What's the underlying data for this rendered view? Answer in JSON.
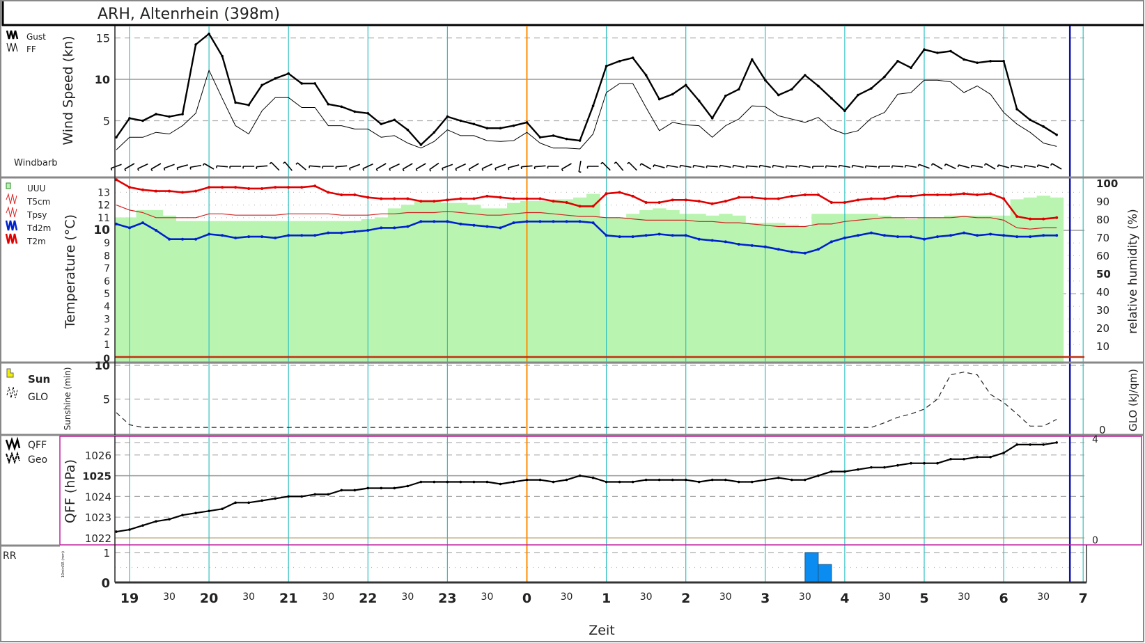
{
  "title": "ARH, Altenrhein (398m)",
  "colors": {
    "gust": "#000000",
    "ff": "#000000",
    "t2m": "#e00000",
    "t5cm": "#d02020",
    "td2m": "#0022cc",
    "uuu": "#b9f5b0",
    "rr": "#0a8cf0",
    "hour_grid": "#30c0c0",
    "now_line": "#ff8c00",
    "end_line": "#1010b0",
    "qff_box": "#c020a0"
  },
  "legends": {
    "wind": [
      "Gust",
      "FF"
    ],
    "windbarb": "Windbarb",
    "temp": [
      "UUU",
      "T5cm",
      "Tpsy",
      "Td2m",
      "T2m"
    ],
    "sun": [
      "Sun",
      "GLO"
    ],
    "qff": [
      "QFF",
      "Geo"
    ],
    "rr": "RR"
  },
  "axes": {
    "wind_ylabel": "Wind Speed (kn)",
    "temp_ylabel": "Temperature (°C)",
    "rh_ylabel": "relative humidity (%)",
    "sun_ylabel": "Sunshine (min)",
    "glo_ylabel": "GLO (kJ/qm)",
    "qff_ylabel": "QFF (hPa)",
    "rr_ylabel": "10minRR (mm)",
    "xlabel": "Zeit"
  },
  "chart_data": [
    {
      "panel": "wind",
      "type": "line",
      "ylabel": "Wind Speed (kn)",
      "ylim": [
        0,
        16
      ],
      "yticks": [
        "5",
        "10",
        "15"
      ],
      "grid": true,
      "x_start": "18:50",
      "x_step_min": 10,
      "series": [
        {
          "name": "Gust",
          "values": [
            3.0,
            5.3,
            5.0,
            5.8,
            5.5,
            5.8,
            14.2,
            15.5,
            12.8,
            7.2,
            6.9,
            9.3,
            10.1,
            10.7,
            9.5,
            9.5,
            7.0,
            6.7,
            6.1,
            5.9,
            4.6,
            5.1,
            3.9,
            2.1,
            3.6,
            5.5,
            5.0,
            4.6,
            4.1,
            4.1,
            4.4,
            4.8,
            3.0,
            3.2,
            2.8,
            2.6,
            6.8,
            11.6,
            12.2,
            12.6,
            10.5,
            7.6,
            8.2,
            9.3,
            7.4,
            5.3,
            8.0,
            8.8,
            12.4,
            9.9,
            8.1,
            8.8,
            10.5,
            9.2,
            7.7,
            6.2,
            8.1,
            8.9,
            10.3,
            12.2,
            11.4,
            13.6,
            13.2,
            13.4,
            12.4,
            12.0,
            12.2,
            12.2,
            6.4,
            5.1,
            4.3,
            3.3
          ]
        },
        {
          "name": "FF",
          "values": [
            1.5,
            3.0,
            3.0,
            3.6,
            3.4,
            4.4,
            5.9,
            11.1,
            7.7,
            4.4,
            3.4,
            6.2,
            7.8,
            7.8,
            6.6,
            6.6,
            4.4,
            4.4,
            4.0,
            4.0,
            3.0,
            3.2,
            2.3,
            1.7,
            2.5,
            3.9,
            3.2,
            3.2,
            2.6,
            2.5,
            2.6,
            3.6,
            2.3,
            1.7,
            1.7,
            1.6,
            3.4,
            8.4,
            9.5,
            9.5,
            6.6,
            3.8,
            4.8,
            4.5,
            4.4,
            3.0,
            4.4,
            5.2,
            6.8,
            6.7,
            5.6,
            5.2,
            4.8,
            5.4,
            4.0,
            3.4,
            3.8,
            5.3,
            6.0,
            8.2,
            8.4,
            9.9,
            9.9,
            9.7,
            8.4,
            9.2,
            8.2,
            6.0,
            4.6,
            3.6,
            2.3,
            1.9
          ]
        }
      ],
      "windbarb_dir_deg": [
        250,
        240,
        245,
        240,
        250,
        255,
        260,
        300,
        275,
        270,
        270,
        265,
        315,
        320,
        310,
        275,
        270,
        265,
        250,
        245,
        240,
        245,
        240,
        240,
        235,
        250,
        245,
        240,
        245,
        250,
        255,
        265,
        265,
        270,
        240,
        190,
        270,
        315,
        320,
        315,
        300,
        285,
        280,
        280,
        280,
        275,
        280,
        280,
        275,
        280,
        280,
        275,
        280,
        270,
        275,
        280,
        280,
        275,
        270,
        275,
        280,
        290,
        300,
        295,
        285,
        280,
        300,
        285,
        280,
        280,
        285,
        300
      ]
    },
    {
      "panel": "temperature",
      "type": "line",
      "ylabel": "Temperature (°C)",
      "ylim": [
        0,
        14
      ],
      "yticks": [
        "0",
        "1",
        "2",
        "3",
        "4",
        "5",
        "6",
        "7",
        "8",
        "9",
        "10",
        "11",
        "12",
        "13"
      ],
      "y2label": "relative humidity (%)",
      "y2lim": [
        0,
        100
      ],
      "y2ticks": [
        "0",
        "10",
        "20",
        "30",
        "40",
        "50",
        "60",
        "70",
        "80",
        "90",
        "100"
      ],
      "x_start": "18:50",
      "x_step_min": 10,
      "series": [
        {
          "name": "T2m",
          "values": [
            14.0,
            13.4,
            13.2,
            13.1,
            13.1,
            13.0,
            13.1,
            13.4,
            13.4,
            13.4,
            13.3,
            13.3,
            13.4,
            13.4,
            13.4,
            13.5,
            13.0,
            12.8,
            12.8,
            12.6,
            12.5,
            12.5,
            12.5,
            12.3,
            12.3,
            12.4,
            12.5,
            12.5,
            12.7,
            12.6,
            12.5,
            12.5,
            12.5,
            12.3,
            12.2,
            11.9,
            11.9,
            12.9,
            13.0,
            12.7,
            12.2,
            12.2,
            12.4,
            12.4,
            12.3,
            12.1,
            12.3,
            12.6,
            12.6,
            12.5,
            12.5,
            12.7,
            12.8,
            12.8,
            12.2,
            12.2,
            12.4,
            12.5,
            12.5,
            12.7,
            12.7,
            12.8,
            12.8,
            12.8,
            12.9,
            12.8,
            12.9,
            12.5,
            11.1,
            10.9,
            10.9,
            11.0
          ]
        },
        {
          "name": "T5cm",
          "values": [
            12.0,
            11.6,
            11.4,
            11.0,
            11.0,
            11.0,
            11.0,
            11.3,
            11.3,
            11.2,
            11.2,
            11.2,
            11.2,
            11.3,
            11.3,
            11.3,
            11.3,
            11.2,
            11.2,
            11.2,
            11.3,
            11.3,
            11.4,
            11.4,
            11.4,
            11.5,
            11.4,
            11.3,
            11.2,
            11.2,
            11.3,
            11.4,
            11.4,
            11.3,
            11.2,
            11.1,
            11.1,
            11.0,
            11.0,
            10.9,
            10.8,
            10.8,
            10.8,
            10.8,
            10.7,
            10.7,
            10.6,
            10.6,
            10.5,
            10.4,
            10.3,
            10.3,
            10.3,
            10.5,
            10.5,
            10.7,
            10.8,
            10.9,
            11.0,
            11.0,
            11.0,
            11.0,
            11.0,
            11.0,
            11.1,
            11.0,
            11.0,
            10.8,
            10.2,
            10.1,
            10.2,
            10.2
          ]
        },
        {
          "name": "Td2m",
          "values": [
            10.5,
            10.2,
            10.6,
            10.0,
            9.3,
            9.3,
            9.3,
            9.7,
            9.6,
            9.4,
            9.5,
            9.5,
            9.4,
            9.6,
            9.6,
            9.6,
            9.8,
            9.8,
            9.9,
            10.0,
            10.2,
            10.2,
            10.3,
            10.7,
            10.7,
            10.7,
            10.5,
            10.4,
            10.3,
            10.2,
            10.6,
            10.7,
            10.7,
            10.7,
            10.7,
            10.7,
            10.6,
            9.6,
            9.5,
            9.5,
            9.6,
            9.7,
            9.6,
            9.6,
            9.3,
            9.2,
            9.1,
            8.9,
            8.8,
            8.7,
            8.5,
            8.3,
            8.2,
            8.5,
            9.1,
            9.4,
            9.6,
            9.8,
            9.6,
            9.5,
            9.5,
            9.3,
            9.5,
            9.6,
            9.8,
            9.6,
            9.7,
            9.6,
            9.5,
            9.5,
            9.6,
            9.6
          ]
        },
        {
          "name": "UUU",
          "axis": "y2",
          "values": [
            81,
            81,
            85,
            85,
            82,
            79,
            79,
            79,
            79,
            79,
            79,
            79,
            79,
            79,
            79,
            79,
            79,
            79,
            79,
            80,
            81,
            86,
            88,
            90,
            90,
            89,
            89,
            88,
            86,
            86,
            89,
            90,
            90,
            91,
            91,
            92,
            94,
            81,
            81,
            83,
            85,
            86,
            85,
            83,
            83,
            82,
            83,
            82,
            78,
            78,
            78,
            77,
            76,
            83,
            83,
            83,
            83,
            83,
            82,
            81,
            80,
            81,
            81,
            82,
            82,
            82,
            82,
            82,
            91,
            92,
            93,
            92
          ]
        }
      ]
    },
    {
      "panel": "sunshine",
      "type": "line",
      "ylabel": "Sunshine (min)",
      "ylim": [
        0,
        10
      ],
      "yticks": [
        "0",
        "5",
        "10"
      ],
      "y2label": "GLO (kJ/qm)",
      "y2ticks": [
        "0"
      ],
      "x_start": "18:50",
      "x_step_min": 10,
      "series": [
        {
          "name": "GLO",
          "values": [
            3.0,
            1.2,
            0.8,
            0.8,
            0.8,
            0.8,
            0.8,
            0.8,
            0.8,
            0.8,
            0.8,
            0.8,
            0.8,
            0.8,
            0.8,
            0.8,
            0.8,
            0.8,
            0.8,
            0.8,
            0.8,
            0.8,
            0.8,
            0.8,
            0.8,
            0.8,
            0.8,
            0.8,
            0.8,
            0.8,
            0.8,
            0.8,
            0.8,
            0.8,
            0.8,
            0.8,
            0.8,
            0.8,
            0.8,
            0.8,
            0.8,
            0.8,
            0.8,
            0.8,
            0.8,
            0.8,
            0.8,
            0.8,
            0.8,
            0.8,
            0.8,
            0.8,
            0.8,
            0.8,
            0.8,
            0.8,
            0.8,
            0.8,
            1.5,
            2.3,
            2.8,
            3.5,
            5.0,
            8.6,
            9.0,
            8.6,
            5.7,
            4.5,
            2.8,
            1.0,
            1.0,
            2.0
          ]
        },
        {
          "name": "Sun",
          "values": []
        }
      ]
    },
    {
      "panel": "qff",
      "type": "line",
      "ylabel": "QFF (hPa)",
      "ylim": [
        1022,
        1026.8
      ],
      "yticks": [
        "1022",
        "1023",
        "1024",
        "1025",
        "1026"
      ],
      "y2ticks": [
        "0",
        "4"
      ],
      "x_start": "18:50",
      "x_step_min": 10,
      "series": [
        {
          "name": "QFF",
          "values": [
            1022.3,
            1022.4,
            1022.6,
            1022.8,
            1022.9,
            1023.1,
            1023.2,
            1023.3,
            1023.4,
            1023.7,
            1023.7,
            1023.8,
            1023.9,
            1024.0,
            1024.0,
            1024.1,
            1024.1,
            1024.3,
            1024.3,
            1024.4,
            1024.4,
            1024.4,
            1024.5,
            1024.7,
            1024.7,
            1024.7,
            1024.7,
            1024.7,
            1024.7,
            1024.6,
            1024.7,
            1024.8,
            1024.8,
            1024.7,
            1024.8,
            1025.0,
            1024.9,
            1024.7,
            1024.7,
            1024.7,
            1024.8,
            1024.8,
            1024.8,
            1024.8,
            1024.7,
            1024.8,
            1024.8,
            1024.7,
            1024.7,
            1024.8,
            1024.9,
            1024.8,
            1024.8,
            1025.0,
            1025.2,
            1025.2,
            1025.3,
            1025.4,
            1025.4,
            1025.5,
            1025.6,
            1025.6,
            1025.6,
            1025.8,
            1025.8,
            1025.9,
            1025.9,
            1026.1,
            1026.5,
            1026.5,
            1026.5,
            1026.6
          ]
        }
      ]
    },
    {
      "panel": "rr",
      "type": "bar",
      "ylabel": "10minRR (mm)",
      "ylim": [
        0,
        1
      ],
      "yticks": [
        "0",
        "1"
      ],
      "bars": [
        {
          "x": "03:30",
          "value": 1.0
        },
        {
          "x": "03:40",
          "value": 0.6
        }
      ]
    }
  ],
  "xaxis": {
    "labels": [
      {
        "t": "19",
        "bold": true
      },
      {
        "t": "30"
      },
      {
        "t": "20",
        "bold": true
      },
      {
        "t": "30"
      },
      {
        "t": "21",
        "bold": true
      },
      {
        "t": "30"
      },
      {
        "t": "22",
        "bold": true
      },
      {
        "t": "30"
      },
      {
        "t": "23",
        "bold": true
      },
      {
        "t": "30"
      },
      {
        "t": "0",
        "bold": true
      },
      {
        "t": "30"
      },
      {
        "t": "1",
        "bold": true
      },
      {
        "t": "30"
      },
      {
        "t": "2",
        "bold": true
      },
      {
        "t": "30"
      },
      {
        "t": "3",
        "bold": true
      },
      {
        "t": "30"
      },
      {
        "t": "4",
        "bold": true
      },
      {
        "t": "30"
      },
      {
        "t": "5",
        "bold": true
      },
      {
        "t": "30"
      },
      {
        "t": "6",
        "bold": true
      },
      {
        "t": "30"
      },
      {
        "t": "7",
        "bold": true
      }
    ],
    "now_marker": "0",
    "end_marker": "06:50"
  }
}
